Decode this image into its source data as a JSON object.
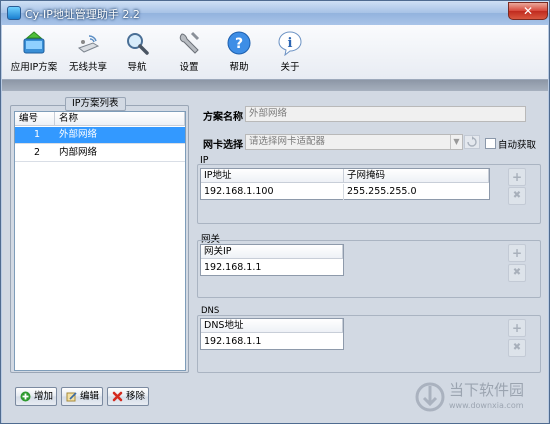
{
  "window": {
    "title": "Cy-IP地址管理助手 2.2",
    "close_glyph": "✕"
  },
  "toolbar": {
    "items": [
      {
        "label": "应用IP方案",
        "icon": "apply-plan-icon"
      },
      {
        "label": "无线共享",
        "icon": "wireless-share-icon"
      },
      {
        "label": "导航",
        "icon": "magnifier-icon"
      },
      {
        "label": "设置",
        "icon": "wrench-icon"
      },
      {
        "label": "帮助",
        "icon": "help-icon"
      },
      {
        "label": "关于",
        "icon": "info-icon"
      }
    ]
  },
  "plan_list": {
    "title": "IP方案列表",
    "columns": [
      "编号",
      "名称"
    ],
    "rows": [
      {
        "index": "1",
        "name": "外部网络",
        "selected": true
      },
      {
        "index": "2",
        "name": "内部网络",
        "selected": false
      }
    ],
    "buttons": {
      "add": "增加",
      "edit": "编辑",
      "remove": "移除"
    }
  },
  "plan": {
    "name_label": "方案名称",
    "name_value": "外部网络",
    "nic_label": "网卡选择",
    "nic_placeholder": "请选择网卡适配器",
    "auto_label": "自动获取"
  },
  "ip_group": {
    "title": "IP",
    "columns": [
      "IP地址",
      "子网掩码"
    ],
    "ip": "192.168.1.100",
    "mask": "255.255.255.0"
  },
  "gateway_group": {
    "title": "网关",
    "column": "网关IP",
    "value": "192.168.1.1"
  },
  "dns_group": {
    "title": "DNS",
    "column": "DNS地址",
    "value": "192.168.1.1"
  },
  "side_buttons": {
    "add_glyph": "+",
    "remove_glyph": "✖"
  },
  "watermark": {
    "text": "当下软件园",
    "url_text": "www.downxia.com"
  },
  "colors": {
    "selection": "#3399ff",
    "title_bar": "#a7c2e6"
  }
}
